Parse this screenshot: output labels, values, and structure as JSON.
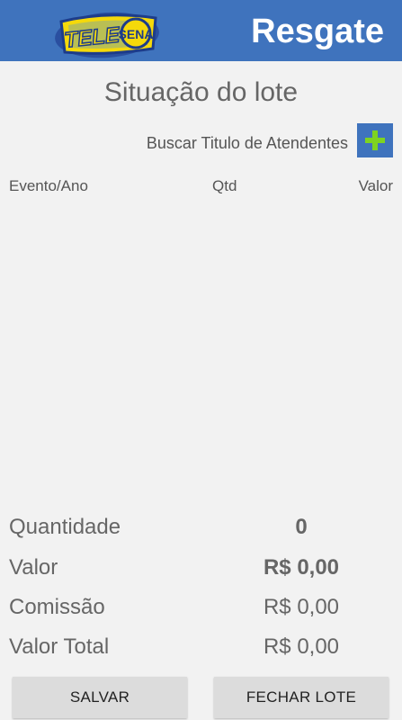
{
  "header": {
    "logo_text": "TELE SENA",
    "title": "Resgate"
  },
  "page_title": "Situação do lote",
  "search": {
    "label": "Buscar Titulo de Atendentes",
    "add_icon": "plus-icon"
  },
  "table": {
    "columns": [
      "Evento/Ano",
      "Qtd",
      "Valor"
    ],
    "rows": []
  },
  "summary": {
    "quantidade_label": "Quantidade",
    "quantidade_value": "0",
    "valor_label": "Valor",
    "valor_value": "R$ 0,00",
    "comissao_label": "Comissão",
    "comissao_value": "R$ 0,00",
    "valor_total_label": "Valor Total",
    "valor_total_value": "R$ 0,00"
  },
  "buttons": {
    "salvar": "SALVAR",
    "fechar_lote": "FECHAR LOTE"
  },
  "colors": {
    "header_blue": "#3f73bd",
    "plus_green": "#7ed321",
    "logo_yellow": "#f5d90a"
  }
}
